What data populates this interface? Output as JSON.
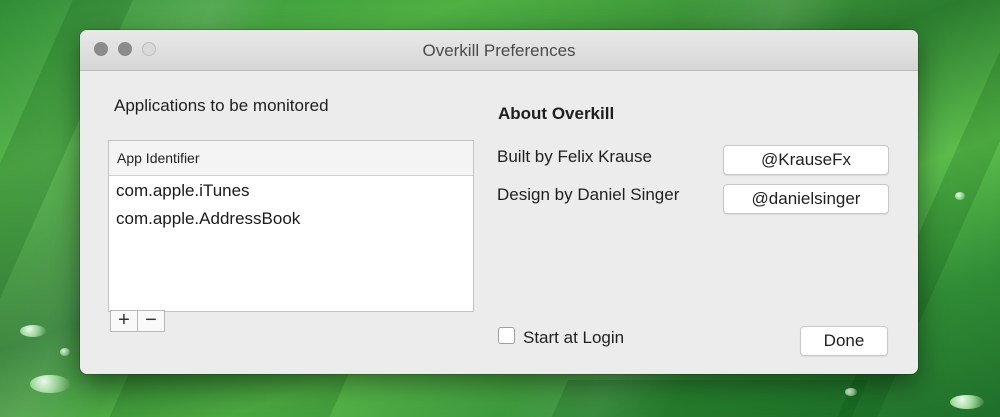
{
  "window": {
    "title": "Overkill Preferences"
  },
  "monitor": {
    "heading": "Applications to be monitored",
    "column_header": "App Identifier",
    "rows": [
      "com.apple.iTunes",
      "com.apple.AddressBook"
    ],
    "add_label": "+",
    "remove_label": "−"
  },
  "about": {
    "heading": "About Overkill",
    "built_label": "Built by Felix Krause",
    "built_handle": "@KrauseFx",
    "design_label": "Design by Daniel Singer",
    "design_handle": "@danielsinger"
  },
  "footer": {
    "start_login_label": "Start at Login",
    "done_label": "Done"
  }
}
